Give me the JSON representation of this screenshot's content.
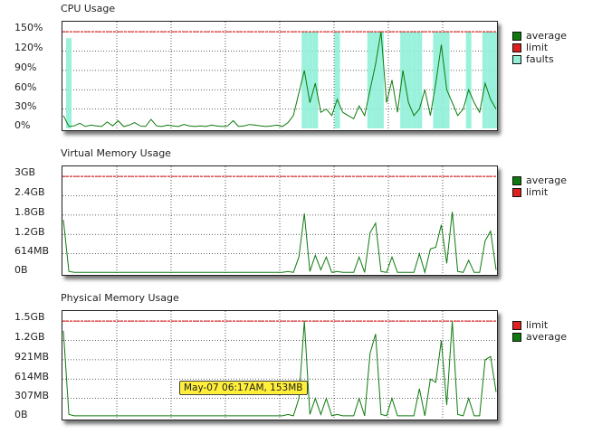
{
  "chart_data": [
    {
      "type": "line",
      "title": "CPU Usage",
      "ylabels": [
        "150%",
        "120%",
        "90%",
        "60%",
        "30%",
        "0%"
      ],
      "ylim": [
        0,
        160
      ],
      "limit": 150,
      "grid": true,
      "legend_placement": "right",
      "series": [
        {
          "name": "average",
          "color": "#0e7a0e"
        },
        {
          "name": "limit",
          "color": "#e02020"
        },
        {
          "name": "faults",
          "color": "#8ff0d8"
        }
      ],
      "x": [
        0,
        1,
        2,
        3,
        4,
        5,
        6,
        7,
        8,
        9,
        10,
        11,
        12,
        13,
        14,
        15,
        16,
        17,
        18,
        19,
        20,
        21,
        22,
        23,
        24,
        25,
        26,
        27,
        28,
        29,
        30,
        31,
        32,
        33,
        34,
        35,
        36,
        37,
        38,
        39,
        40,
        41,
        42,
        43,
        44,
        45,
        46,
        47,
        48,
        49,
        50,
        51,
        52,
        53,
        54,
        55,
        56,
        57,
        58,
        59,
        60,
        61,
        62,
        63,
        64,
        65,
        66,
        67,
        68,
        69,
        70,
        71,
        72,
        73,
        74,
        75,
        76,
        77,
        78,
        79
      ],
      "average": [
        20,
        3,
        4,
        8,
        3,
        5,
        4,
        3,
        10,
        4,
        12,
        3,
        5,
        9,
        4,
        3,
        14,
        4,
        3,
        5,
        4,
        3,
        6,
        4,
        3,
        4,
        3,
        5,
        4,
        3,
        4,
        12,
        3,
        4,
        6,
        5,
        4,
        3,
        4,
        5,
        3,
        9,
        20,
        55,
        90,
        40,
        70,
        25,
        30,
        20,
        45,
        25,
        20,
        15,
        35,
        20,
        60,
        100,
        150,
        40,
        75,
        25,
        90,
        40,
        20,
        30,
        60,
        20,
        70,
        130,
        60,
        40,
        20,
        30,
        60,
        40,
        25,
        70,
        45,
        30
      ],
      "faults": [
        0,
        140,
        0,
        0,
        0,
        0,
        0,
        0,
        0,
        0,
        0,
        0,
        0,
        0,
        0,
        0,
        0,
        0,
        0,
        0,
        0,
        0,
        0,
        0,
        0,
        0,
        0,
        0,
        0,
        0,
        0,
        0,
        0,
        0,
        0,
        0,
        0,
        0,
        0,
        0,
        0,
        0,
        0,
        0,
        150,
        150,
        150,
        0,
        0,
        0,
        150,
        0,
        0,
        0,
        0,
        0,
        150,
        150,
        150,
        0,
        0,
        0,
        150,
        150,
        150,
        150,
        0,
        0,
        150,
        150,
        150,
        0,
        0,
        0,
        150,
        0,
        0,
        150,
        150,
        150
      ]
    },
    {
      "type": "line",
      "title": "Virtual Memory Usage",
      "ylabels": [
        "3GB",
        "2.4GB",
        "1.8GB",
        "1.2GB",
        "614MB",
        "0B"
      ],
      "ylim": [
        0,
        3.2
      ],
      "limit": 3.0,
      "grid": true,
      "legend_placement": "right",
      "series": [
        {
          "name": "average",
          "color": "#0e7a0e"
        },
        {
          "name": "limit",
          "color": "#e02020"
        }
      ],
      "x": [
        0,
        1,
        2,
        3,
        4,
        5,
        6,
        7,
        8,
        9,
        10,
        11,
        12,
        13,
        14,
        15,
        16,
        17,
        18,
        19,
        20,
        21,
        22,
        23,
        24,
        25,
        26,
        27,
        28,
        29,
        30,
        31,
        32,
        33,
        34,
        35,
        36,
        37,
        38,
        39,
        40,
        41,
        42,
        43,
        44,
        45,
        46,
        47,
        48,
        49,
        50,
        51,
        52,
        53,
        54,
        55,
        56,
        57,
        58,
        59,
        60,
        61,
        62,
        63,
        64,
        65,
        66,
        67,
        68,
        69,
        70,
        71,
        72,
        73,
        74,
        75,
        76,
        77,
        78,
        79
      ],
      "average": [
        1.65,
        0.05,
        0.02,
        0.02,
        0.02,
        0.02,
        0.02,
        0.02,
        0.02,
        0.02,
        0.02,
        0.02,
        0.02,
        0.02,
        0.02,
        0.02,
        0.02,
        0.02,
        0.02,
        0.02,
        0.02,
        0.02,
        0.02,
        0.02,
        0.02,
        0.02,
        0.02,
        0.02,
        0.02,
        0.02,
        0.02,
        0.02,
        0.02,
        0.02,
        0.02,
        0.02,
        0.02,
        0.02,
        0.02,
        0.02,
        0.02,
        0.05,
        0.02,
        0.5,
        1.85,
        0.05,
        0.55,
        0.1,
        0.5,
        0.02,
        0.05,
        0.02,
        0.02,
        0.02,
        0.5,
        0.02,
        1.25,
        1.55,
        0.05,
        0.02,
        0.5,
        0.02,
        0.02,
        0.02,
        0.02,
        0.6,
        0.02,
        0.75,
        0.8,
        1.5,
        0.3,
        1.9,
        0.05,
        0.02,
        0.4,
        0.02,
        0.02,
        1.0,
        1.3,
        0.1
      ]
    },
    {
      "type": "line",
      "title": "Physical Memory Usage",
      "ylabels": [
        "1.5GB",
        "1.2GB",
        "921MB",
        "614MB",
        "307MB",
        "0B"
      ],
      "ylim": [
        0,
        1.6
      ],
      "limit": 1.5,
      "grid": true,
      "legend_placement": "right",
      "series": [
        {
          "name": "limit",
          "color": "#e02020"
        },
        {
          "name": "average",
          "color": "#0e7a0e"
        }
      ],
      "x": [
        0,
        1,
        2,
        3,
        4,
        5,
        6,
        7,
        8,
        9,
        10,
        11,
        12,
        13,
        14,
        15,
        16,
        17,
        18,
        19,
        20,
        21,
        22,
        23,
        24,
        25,
        26,
        27,
        28,
        29,
        30,
        31,
        32,
        33,
        34,
        35,
        36,
        37,
        38,
        39,
        40,
        41,
        42,
        43,
        44,
        45,
        46,
        47,
        48,
        49,
        50,
        51,
        52,
        53,
        54,
        55,
        56,
        57,
        58,
        59,
        60,
        61,
        62,
        63,
        64,
        65,
        66,
        67,
        68,
        69,
        70,
        71,
        72,
        73,
        74,
        75,
        76,
        77,
        78,
        79
      ],
      "average": [
        1.35,
        0.05,
        0.03,
        0.03,
        0.03,
        0.03,
        0.03,
        0.03,
        0.03,
        0.03,
        0.03,
        0.03,
        0.03,
        0.03,
        0.03,
        0.03,
        0.03,
        0.03,
        0.03,
        0.03,
        0.03,
        0.03,
        0.03,
        0.03,
        0.03,
        0.03,
        0.03,
        0.03,
        0.03,
        0.03,
        0.03,
        0.03,
        0.03,
        0.03,
        0.03,
        0.03,
        0.03,
        0.03,
        0.03,
        0.03,
        0.03,
        0.05,
        0.03,
        0.3,
        1.5,
        0.05,
        0.3,
        0.05,
        0.3,
        0.03,
        0.05,
        0.03,
        0.03,
        0.03,
        0.3,
        0.03,
        1.0,
        1.3,
        0.05,
        0.03,
        0.3,
        0.03,
        0.03,
        0.03,
        0.03,
        0.45,
        0.03,
        0.6,
        0.55,
        1.2,
        0.2,
        1.5,
        0.05,
        0.03,
        0.3,
        0.03,
        0.03,
        0.9,
        0.95,
        0.4
      ]
    }
  ],
  "tooltip": {
    "text": "May-07 06:17AM, 153MB"
  }
}
